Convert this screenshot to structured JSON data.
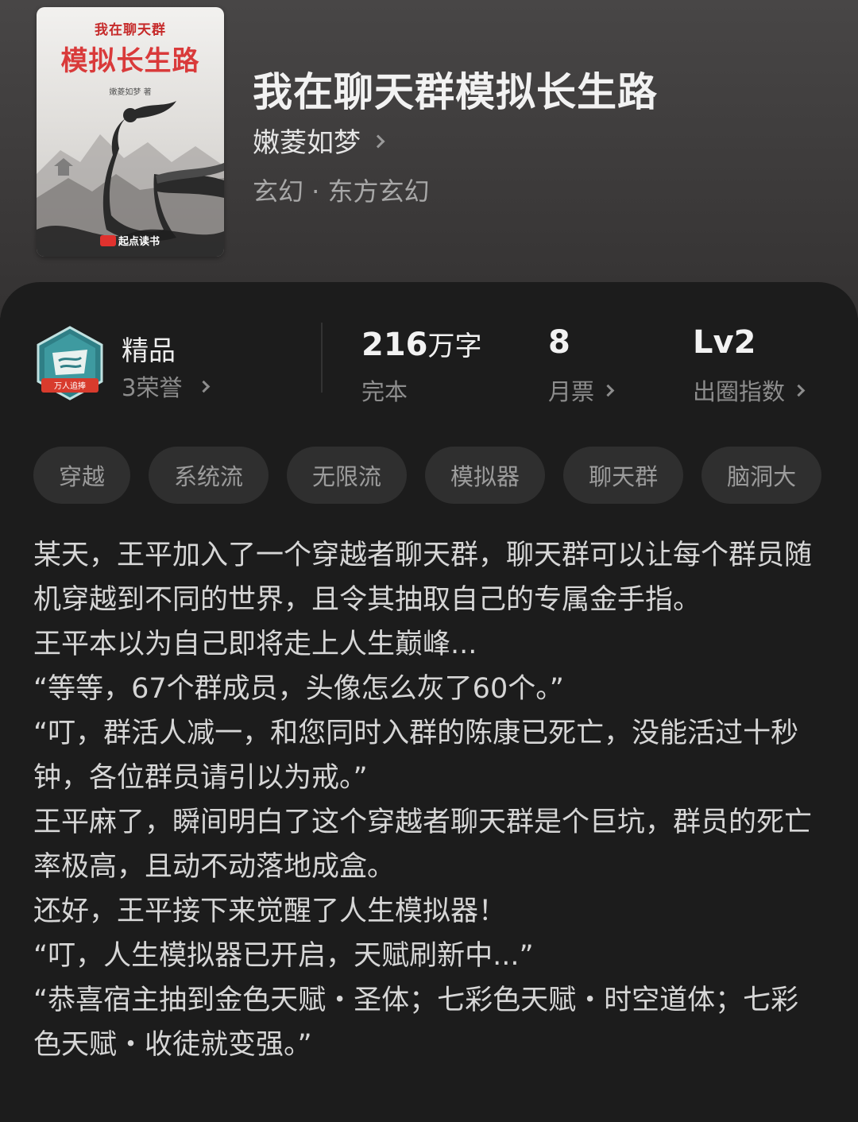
{
  "book": {
    "title": "我在聊天群模拟长生路",
    "author": "嫩菱如梦",
    "genre": "玄幻 · 东方玄幻"
  },
  "cover": {
    "small_title": "我在聊天群",
    "big_title": "模拟长生路",
    "author_line": "嫩菱如梦 著",
    "publisher": "起点读书"
  },
  "honor": {
    "badge_text": "万人追捧",
    "title": "精品",
    "count_label": "3荣誉"
  },
  "stats": {
    "words_value": "216",
    "words_unit": "万字",
    "words_label": "完本",
    "tickets_value": "8",
    "tickets_label": "月票",
    "level_value": "Lv2",
    "level_label": "出圈指数"
  },
  "tags": [
    "穿越",
    "系统流",
    "无限流",
    "模拟器",
    "聊天群",
    "脑洞大"
  ],
  "description": [
    "某天，王平加入了一个穿越者聊天群，聊天群可以让每个群员随机穿越到不同的世界，且令其抽取自己的专属金手指。",
    "王平本以为自己即将走上人生巅峰...",
    "“等等，67个群成员，头像怎么灰了60个。”",
    "“叮，群活人减一，和您同时入群的陈康已死亡，没能活过十秒钟，各位群员请引以为戒。”",
    "王平麻了，瞬间明白了这个穿越者聊天群是个巨坑，群员的死亡率极高，且动不动落地成盒。",
    "还好，王平接下来觉醒了人生模拟器！",
    "“叮，人生模拟器已开启，天赋刷新中...”",
    "“恭喜宿主抽到金色天赋・圣体；七彩色天赋・时空道体；七彩色天赋・收徒就变强。”"
  ],
  "colors": {
    "header_bg": "#454343",
    "card_bg": "#1c1c1c",
    "tag_bg": "#2f2f2f",
    "cover_title_red": "#d93a3a"
  }
}
